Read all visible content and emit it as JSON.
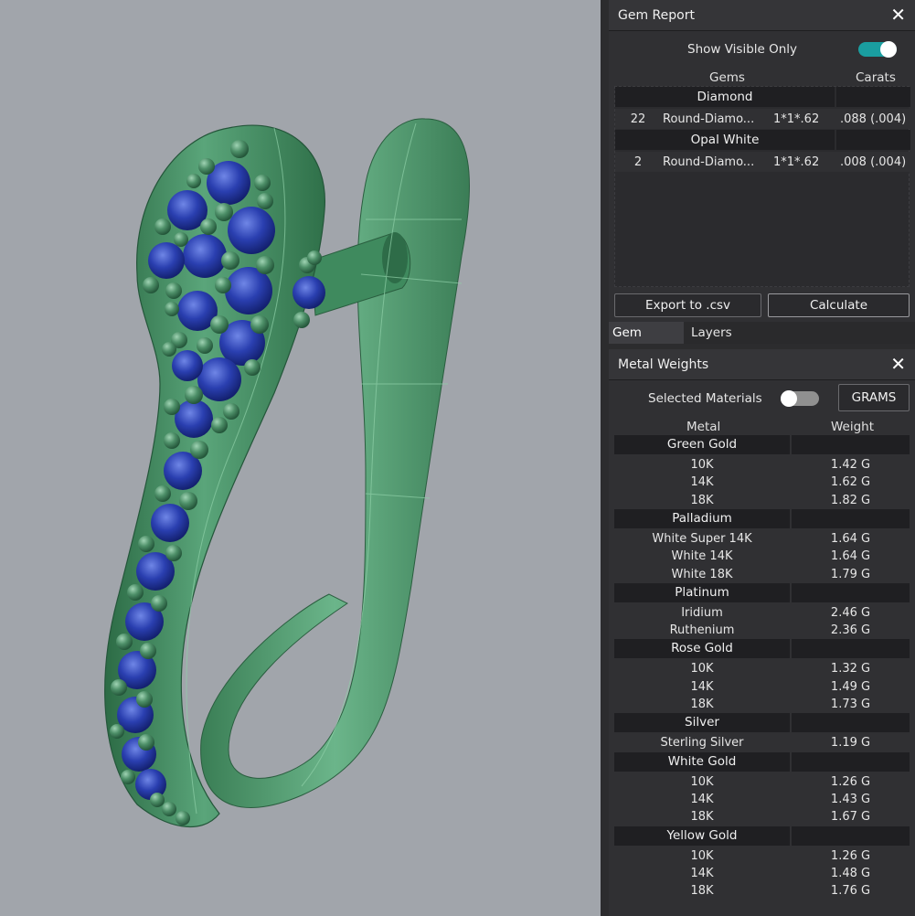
{
  "gem_report": {
    "title": "Gem Report",
    "close_icon": "close-icon",
    "show_visible_label": "Show Visible Only",
    "show_visible_on": true,
    "col_gems": "Gems",
    "col_carats": "Carats",
    "groups": [
      {
        "name": "Diamond",
        "rows": [
          {
            "count": "22",
            "shape": "Round-Diamo...",
            "size": "1*1*.62",
            "carats": ".088 (.004)"
          }
        ]
      },
      {
        "name": "Opal White",
        "rows": [
          {
            "count": "2",
            "shape": "Round-Diamo...",
            "size": "1*1*.62",
            "carats": ".008 (.004)"
          }
        ]
      }
    ],
    "export_label": "Export to .csv",
    "calculate_label": "Calculate"
  },
  "tabs": {
    "gem_report": "Gem Report",
    "layers": "Layers"
  },
  "metal_weights": {
    "title": "Metal Weights",
    "selected_materials_label": "Selected Materials",
    "selected_materials_on": false,
    "units_label": "GRAMS",
    "col_metal": "Metal",
    "col_weight": "Weight",
    "groups": [
      {
        "name": "Green Gold",
        "rows": [
          {
            "metal": "10K",
            "weight": "1.42 G"
          },
          {
            "metal": "14K",
            "weight": "1.62 G"
          },
          {
            "metal": "18K",
            "weight": "1.82 G"
          }
        ]
      },
      {
        "name": "Palladium",
        "rows": [
          {
            "metal": "White Super 14K",
            "weight": "1.64 G"
          },
          {
            "metal": "White 14K",
            "weight": "1.64 G"
          },
          {
            "metal": "White 18K",
            "weight": "1.79 G"
          }
        ]
      },
      {
        "name": "Platinum",
        "rows": [
          {
            "metal": "Iridium",
            "weight": "2.46 G"
          },
          {
            "metal": "Ruthenium",
            "weight": "2.36 G"
          }
        ]
      },
      {
        "name": "Rose Gold",
        "rows": [
          {
            "metal": "10K",
            "weight": "1.32 G"
          },
          {
            "metal": "14K",
            "weight": "1.49 G"
          },
          {
            "metal": "18K",
            "weight": "1.73 G"
          }
        ]
      },
      {
        "name": "Silver",
        "rows": [
          {
            "metal": "Sterling Silver",
            "weight": "1.19 G"
          }
        ]
      },
      {
        "name": "White Gold",
        "rows": [
          {
            "metal": "10K",
            "weight": "1.26 G"
          },
          {
            "metal": "14K",
            "weight": "1.43 G"
          },
          {
            "metal": "18K",
            "weight": "1.67 G"
          }
        ]
      },
      {
        "name": "Yellow Gold",
        "rows": [
          {
            "metal": "10K",
            "weight": "1.26 G"
          },
          {
            "metal": "14K",
            "weight": "1.48 G"
          },
          {
            "metal": "18K",
            "weight": "1.76 G"
          }
        ]
      }
    ]
  },
  "colors": {
    "viewport_bg": "#a1a5ab",
    "panel_bg": "#303033",
    "accent_toggle": "#1a9ea0",
    "metal_green": "#3f8a5e",
    "gem_blue": "#1f35a0"
  }
}
